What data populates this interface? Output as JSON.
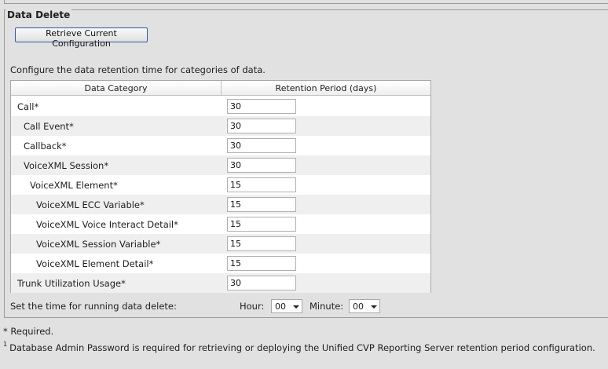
{
  "section": {
    "title": "Data Delete",
    "retrieve_button": "Retrieve Current Configuration",
    "configure_text": "Configure the data retention time for categories of data."
  },
  "table": {
    "headers": [
      "Data Category",
      "Retention Period (days)"
    ],
    "rows": [
      {
        "category": "Call*",
        "days": "30"
      },
      {
        "category": "Call Event*",
        "days": "30"
      },
      {
        "category": "Callback*",
        "days": "30"
      },
      {
        "category": "VoiceXML Session*",
        "days": "30"
      },
      {
        "category": "VoiceXML Element*",
        "days": "15"
      },
      {
        "category": "VoiceXML ECC Variable*",
        "days": "15"
      },
      {
        "category": "VoiceXML Voice Interact Detail*",
        "days": "15"
      },
      {
        "category": "VoiceXML Session Variable*",
        "days": "15"
      },
      {
        "category": "VoiceXML Element Detail*",
        "days": "15"
      },
      {
        "category": "Trunk Utilization Usage*",
        "days": "30"
      }
    ]
  },
  "schedule": {
    "label": "Set the time for running data delete:",
    "hour_label": "Hour:",
    "hour_value": "00",
    "minute_label": "Minute:",
    "minute_value": "00"
  },
  "notes": {
    "required": "* Required.",
    "footnote_mark": "1",
    "footnote": "Database Admin Password is required for retrieving or deploying the Unified CVP Reporting Server retention period configuration."
  }
}
